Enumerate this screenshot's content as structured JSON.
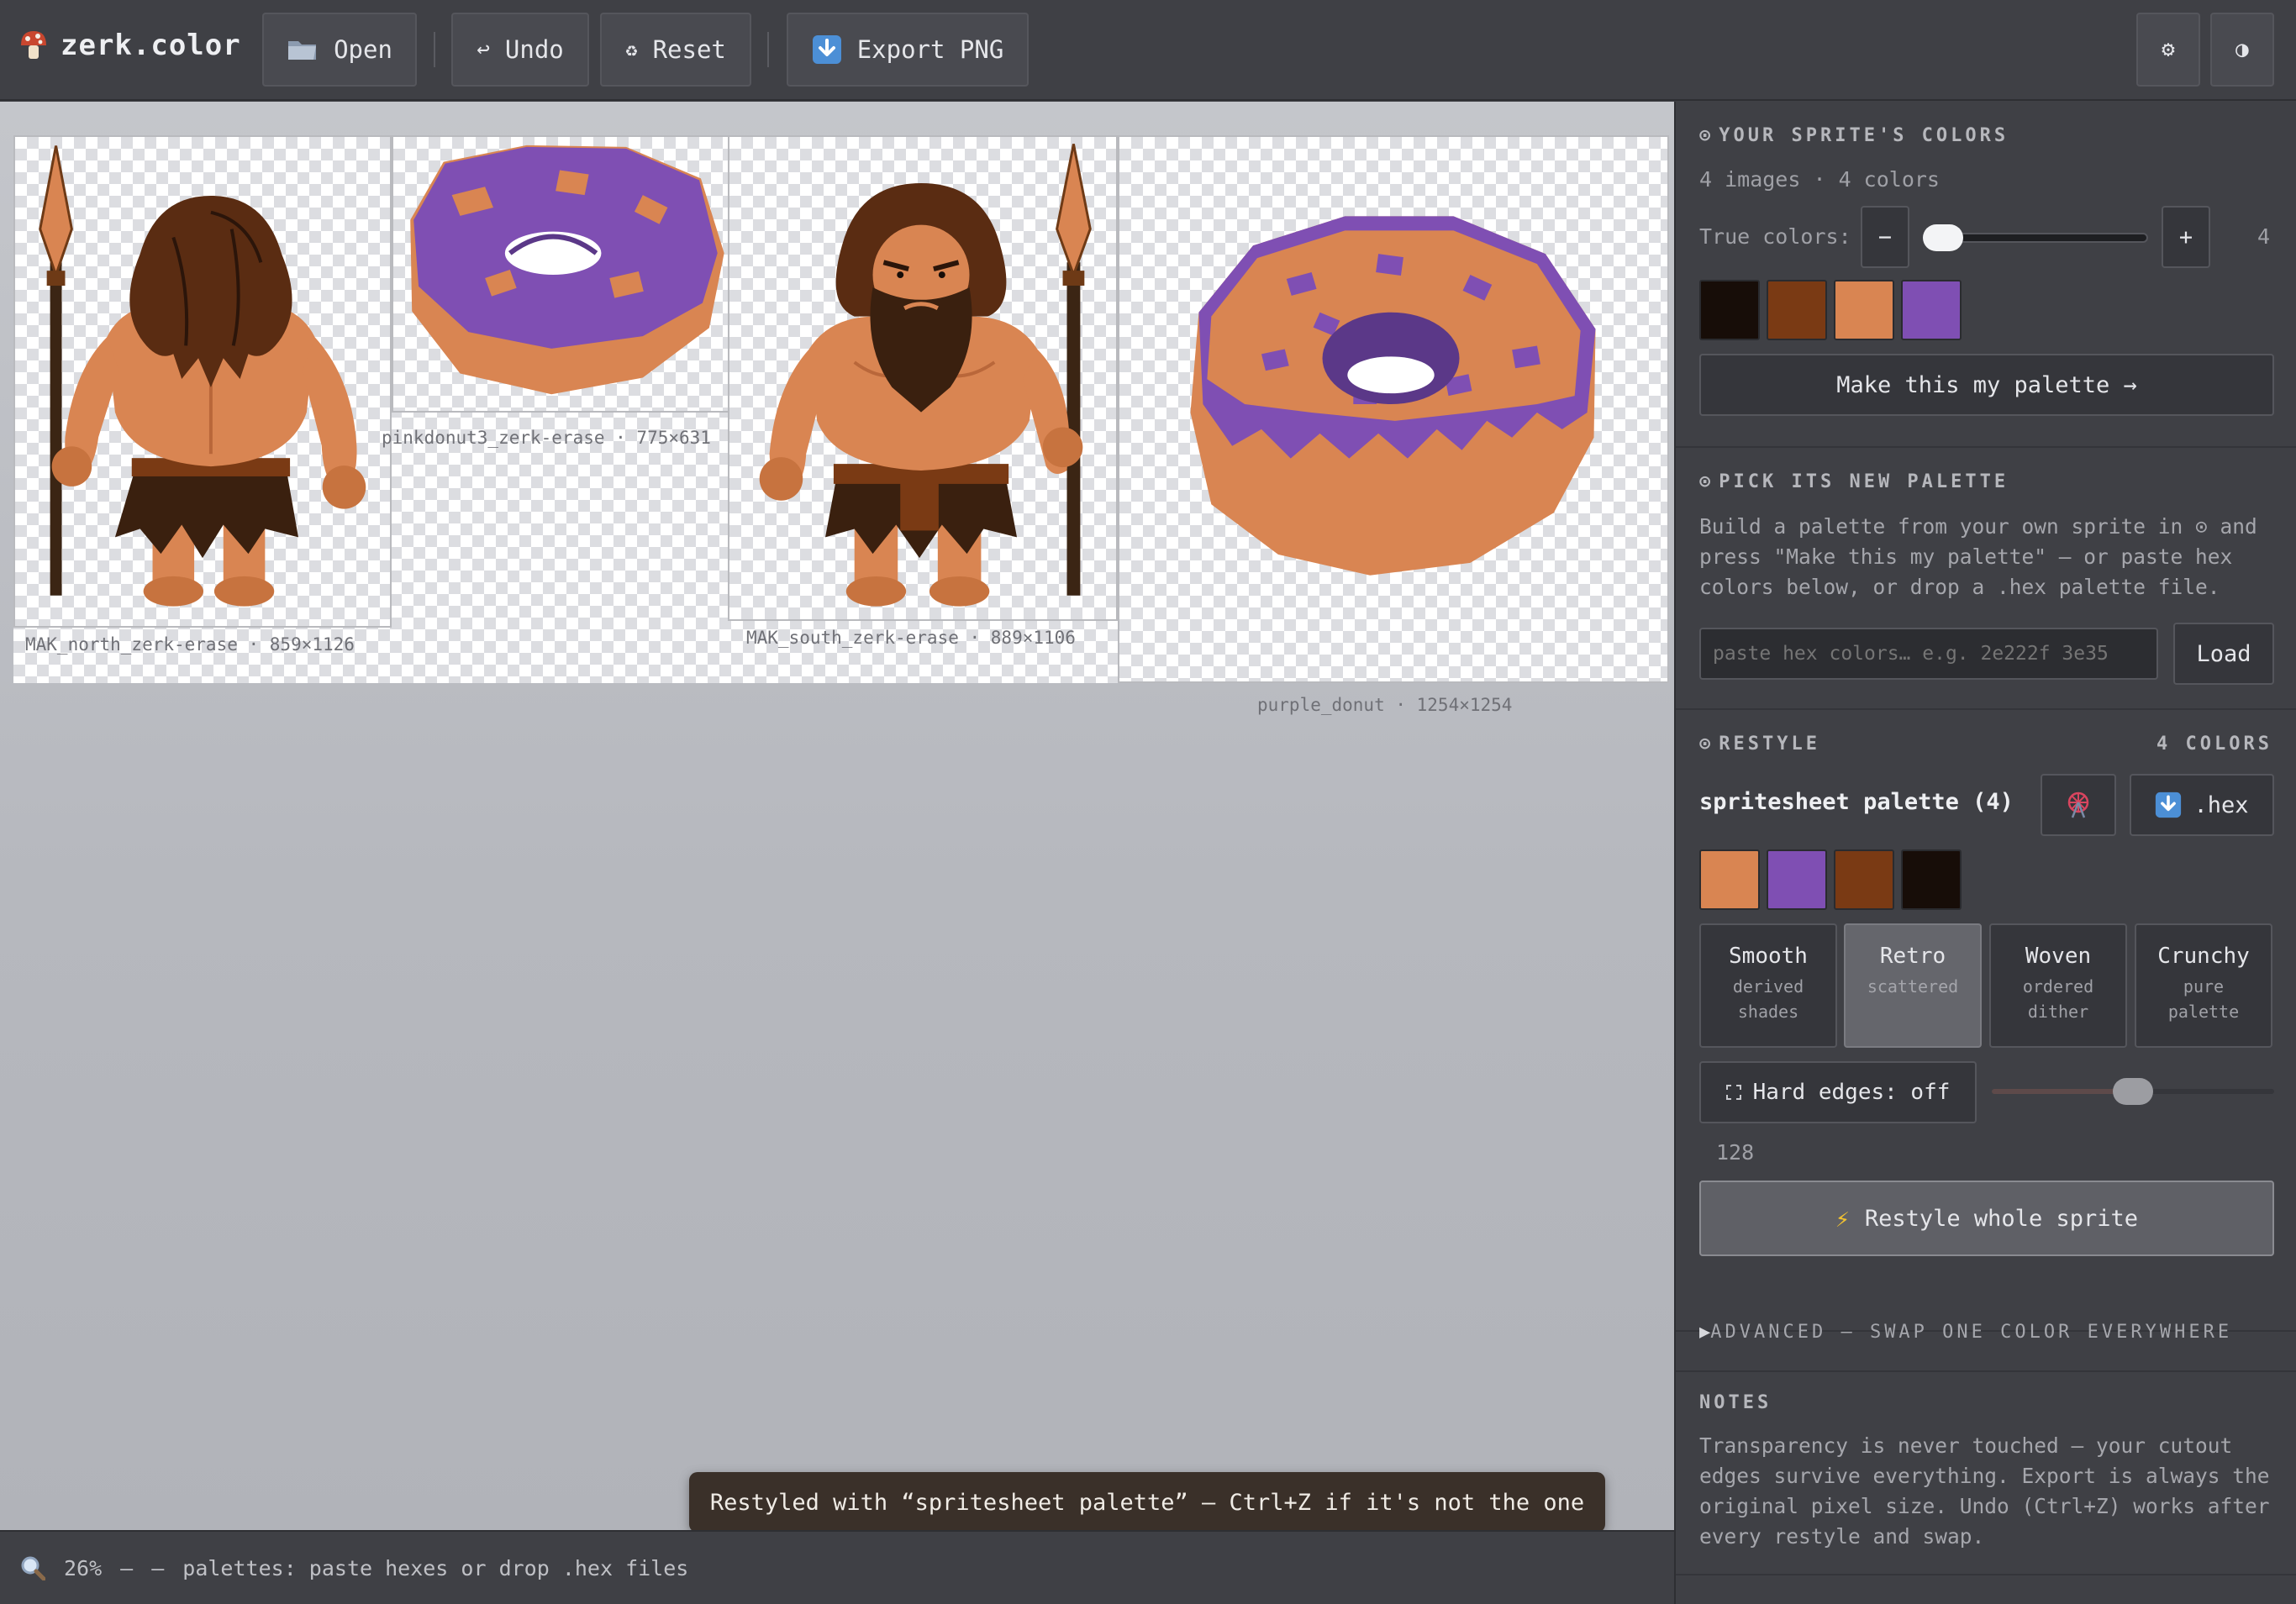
{
  "app": {
    "title": "zerk.color",
    "logo_icon": "mushroom-icon"
  },
  "toolbar": {
    "open_label": "Open",
    "open_icon": "folder-icon",
    "undo_label": "Undo",
    "undo_icon": "undo-arrow-icon",
    "reset_label": "Reset",
    "reset_icon": "recycle-icon",
    "export_label": "Export PNG",
    "export_icon": "down-arrow-box-icon",
    "settings_icon": "gear-icon",
    "theme_icon": "contrast-icon",
    "settings_glyph": "⚙",
    "theme_glyph": "◑"
  },
  "canvas": {
    "sprites": [
      {
        "name": "MAK_north_zerk-erase",
        "size": "859×1126",
        "caption": "MAK_north_zerk-erase · 859×1126"
      },
      {
        "name": "pinkdonut3_zerk-erase",
        "size": "775×631",
        "caption": "pinkdonut3_zerk-erase · 775×631"
      },
      {
        "name": "MAK_south_zerk-erase",
        "size": "889×1106",
        "caption": "MAK_south_zerk-erase · 889×1106"
      },
      {
        "name": "purple_donut",
        "size": "1254×1254",
        "caption": "purple_donut · 1254×1254"
      }
    ]
  },
  "statusbar": {
    "zoom": "26%",
    "dash1": "—",
    "dash2": "—",
    "hint": "palettes: paste hexes or drop .hex files"
  },
  "toast": {
    "message": "Restyled with “spritesheet palette” — Ctrl+Z if it's not the one"
  },
  "colors_section": {
    "heading": "YOUR SPRITE'S COLORS",
    "heading_icon": "⊙",
    "summary": "4 images · 4 colors",
    "true_colors_label": "True colors:",
    "minus": "−",
    "plus": "+",
    "count": "4",
    "slider_level_fraction": 0.0,
    "swatches": [
      "#170d08",
      "#7a3a14",
      "#d98552",
      "#7f4fb3"
    ],
    "make_palette_label": "Make this my palette →"
  },
  "palette_section": {
    "heading": "PICK ITS NEW PALETTE",
    "heading_icon": "⊙",
    "description": "Build a palette from your own sprite in ⊙ and press \"Make this my palette\" — or paste hex colors below, or drop a .hex palette file.",
    "hex_input_placeholder": "paste hex colors… e.g. 2e222f 3e35",
    "load_label": "Load"
  },
  "restyle_section": {
    "heading": "RESTYLE",
    "heading_icon": "⊙",
    "count_label": "4 COLORS",
    "palette_name": "spritesheet palette (4)",
    "randomize_icon": "ferris-wheel-icon",
    "hex_button_label": ".hex",
    "hex_button_icon": "down-arrow-box-icon",
    "swatches": [
      "#d98552",
      "#7f4fb3",
      "#7a3a14",
      "#170d08"
    ],
    "modes": [
      {
        "title": "Smooth",
        "sub": "derived shades",
        "active": false
      },
      {
        "title": "Retro",
        "sub": "scattered",
        "active": true
      },
      {
        "title": "Woven",
        "sub": "ordered dither",
        "active": false
      },
      {
        "title": "Crunchy",
        "sub": "pure palette",
        "active": false
      }
    ],
    "hard_edges_label": "Hard edges: off",
    "hard_edges_value": "128",
    "hard_edges_level_fraction": 0.5,
    "restyle_button_label": "Restyle whole sprite",
    "restyle_button_icon": "lightning-icon"
  },
  "advanced": {
    "label": "ADVANCED — SWAP ONE COLOR EVERYWHERE",
    "arrow": "▶"
  },
  "notes": {
    "heading": "NOTES",
    "text": "Transparency is never touched — your cutout edges survive everything. Export is always the original pixel size. Undo (Ctrl+Z) works after every restyle and swap."
  }
}
